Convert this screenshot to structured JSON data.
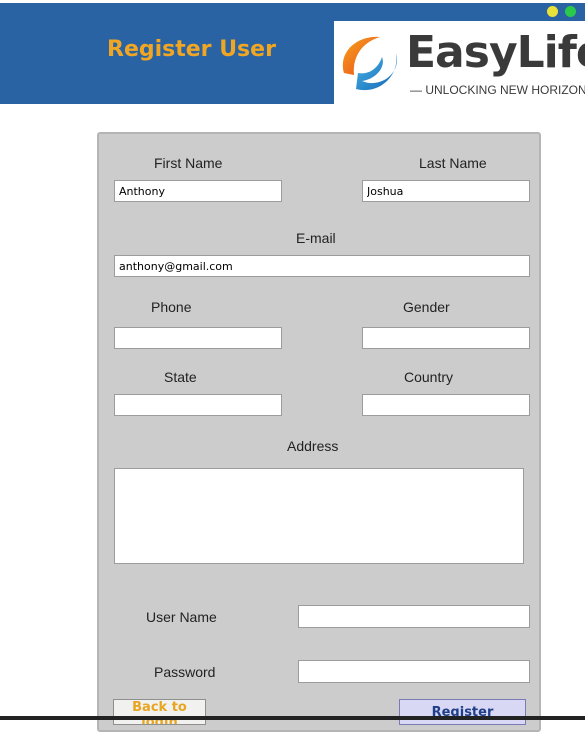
{
  "header": {
    "title": "Register User",
    "logo": {
      "word": "EasyLife",
      "tagline": "— UNLOCKING NEW HORIZONS —"
    },
    "window_dots": [
      {
        "color": "#e8e23a"
      },
      {
        "color": "#2bc94a"
      }
    ]
  },
  "form": {
    "first_name": {
      "label": "First Name",
      "value": "Anthony"
    },
    "last_name": {
      "label": "Last Name",
      "value": "Joshua"
    },
    "email": {
      "label": "E-mail",
      "value": "anthony@gmail.com"
    },
    "phone": {
      "label": "Phone",
      "value": ""
    },
    "gender": {
      "label": "Gender",
      "value": ""
    },
    "state": {
      "label": "State",
      "value": ""
    },
    "country": {
      "label": "Country",
      "value": ""
    },
    "address": {
      "label": "Address",
      "value": ""
    },
    "username": {
      "label": "User Name",
      "value": ""
    },
    "password": {
      "label": "Password",
      "value": ""
    }
  },
  "buttons": {
    "back": {
      "label": "Back to login"
    },
    "register": {
      "label": "Register"
    }
  },
  "colors": {
    "header_bg": "#2a63a3",
    "title": "#f1a623",
    "form_bg": "#cccccc",
    "back_text": "#e8a521",
    "register_text": "#1f3f8a"
  }
}
